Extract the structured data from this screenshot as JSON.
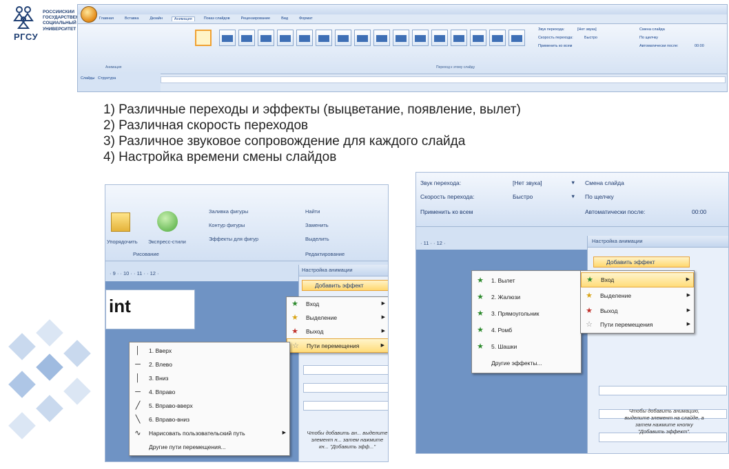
{
  "logo": {
    "abbr": "РГСУ",
    "lines": [
      "РОССИЙСКИЙ",
      "ГОСУДАРСТВЕННЫЙ",
      "СОЦИАЛЬНЫЙ",
      "УНИВЕРСИТЕТ"
    ],
    "color": "#1f3f73"
  },
  "ribbon": {
    "tabs": [
      "Главная",
      "Вставка",
      "Дизайн",
      "Анимация",
      "Показ слайдов",
      "Рецензирование",
      "Вид",
      "Формат"
    ],
    "active_tab": "Анимация",
    "group_label": "Переход к этому слайду",
    "left_group_label": "Анимация",
    "sound_label": "Звук перехода:",
    "sound_value": "[Нет звука]",
    "speed_label": "Скорость перехода:",
    "speed_value": "Быстро",
    "apply_all": "Применить ко всем",
    "advance_title": "Смена слайда",
    "on_click": "По щелчку",
    "auto_after": "Автоматически после:",
    "auto_value": "00:00",
    "pane_tab_1": "Слайды",
    "pane_tab_2": "Структура"
  },
  "points": [
    "1) Различные переходы и эффекты (выцветание, появление, вылет)",
    "2) Различная скорость переходов",
    "3) Различное звуковое сопровождение для каждого слайда",
    "4) Настройка времени смены слайдов"
  ],
  "left_shot": {
    "btn_arrange": "Упорядочить",
    "btn_express": "Экспресс-стили",
    "fill": "Заливка фигуры",
    "outline": "Контур фигуры",
    "effects": "Эффекты для фигур",
    "find": "Найти",
    "replace": "Заменить",
    "select": "Выделить",
    "group_drawing": "Рисование",
    "group_edit": "Редактирование",
    "ruler": "· 9 · · 10 · · 11 · · 12 ·",
    "slide_text": "int",
    "pane_title": "Настройка анимации",
    "add_effect": "Добавить эффект",
    "menu1": [
      {
        "label": "Вход",
        "icon": "star-green-icon"
      },
      {
        "label": "Выделение",
        "icon": "star-yellow-icon"
      },
      {
        "label": "Выход",
        "icon": "star-red-icon"
      },
      {
        "label": "Пути перемещения",
        "icon": "star-outline-icon"
      }
    ],
    "menu2": [
      "1. Вверх",
      "2. Влево",
      "3. Вниз",
      "4. Вправо",
      "5. Вправо-вверх",
      "6. Вправо-вниз",
      "Нарисовать пользовательский путь",
      "Другие пути перемещения..."
    ],
    "hint": "Чтобы добавить ан... выделите элемент н... затем нажмите кн... \"Добавить эфф...\""
  },
  "right_shot": {
    "sound_label": "Звук перехода:",
    "sound_value": "[Нет звука]",
    "speed_label": "Скорость перехода:",
    "speed_value": "Быстро",
    "apply_all": "Применить ко всем",
    "advance_title": "Смена слайда",
    "on_click": "По щелчку",
    "auto_after": "Автоматически после:",
    "auto_value": "00:00",
    "ruler": "· 11 · · 12 ·",
    "pane_title": "Настройка анимации",
    "add_effect": "Добавить эффект",
    "submenu": [
      "1. Вылет",
      "2. Жалюзи",
      "3. Прямоугольник",
      "4. Ромб",
      "5. Шашки",
      "Другие эффекты..."
    ],
    "menu": [
      {
        "label": "Вход",
        "icon": "star-green-icon"
      },
      {
        "label": "Выделение",
        "icon": "star-yellow-icon"
      },
      {
        "label": "Выход",
        "icon": "star-red-icon"
      },
      {
        "label": "Пути перемещения",
        "icon": "star-outline-icon"
      }
    ],
    "hint_lines": [
      "Чтобы добавить анимацию,",
      "выделите элемент на слайде, а",
      "затем нажмите кнопку",
      "\"Добавить эффект\"."
    ]
  },
  "colors": {
    "accent_highlight": "#ffd76e",
    "ribbon_blue": "#d3e1f3",
    "text_blue": "#1e3a6e",
    "diamond_1": "#c9d9ee",
    "diamond_2": "#9fbbe0"
  }
}
